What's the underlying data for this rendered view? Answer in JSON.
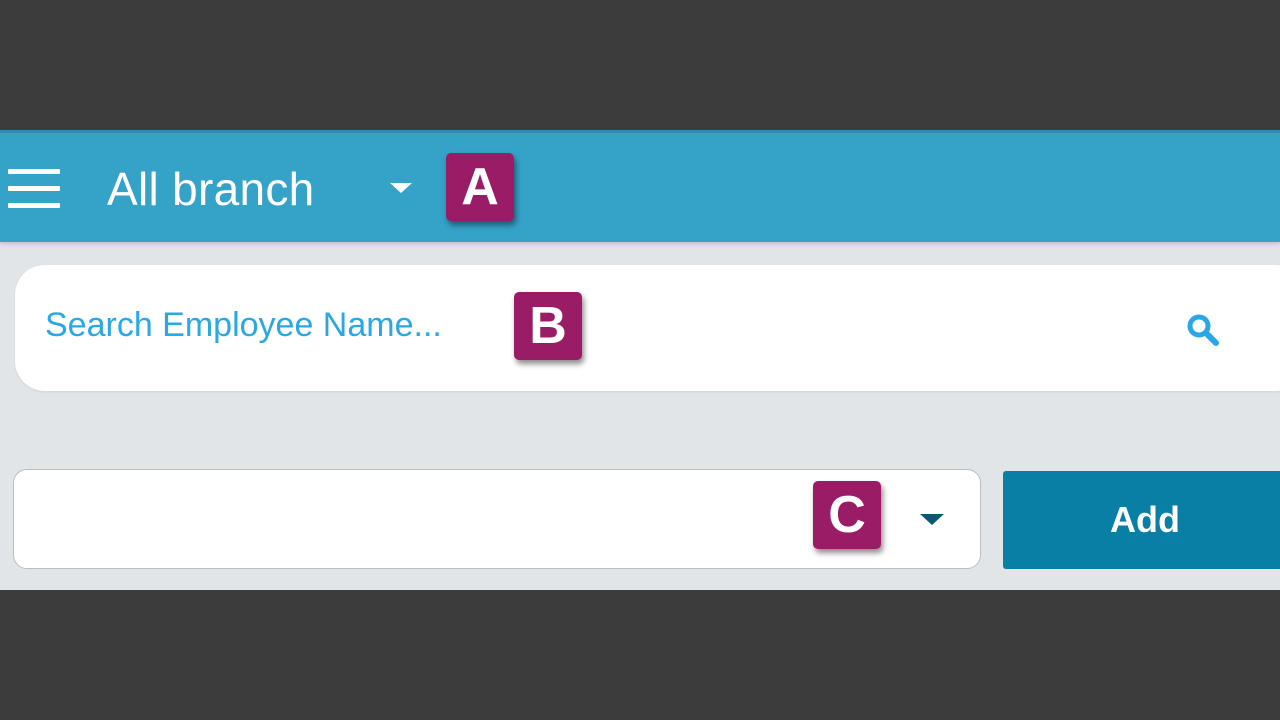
{
  "header": {
    "branch_selector": "All branch"
  },
  "search": {
    "placeholder": "Search Employee Name..."
  },
  "form": {
    "select_value": "",
    "add_label": "Add"
  },
  "annotations": {
    "a": "A",
    "b": "B",
    "c": "C"
  },
  "colors": {
    "appbar": "#35a2c8",
    "badge": "#9b1c66",
    "search_text": "#2aa7e6",
    "add_button": "#0a7fa6",
    "background": "#e1e5e8",
    "frame": "#3c3c3c"
  },
  "icons": {
    "menu": "menu-icon",
    "branch_dropdown": "caret-down-icon",
    "search": "search-icon",
    "select_dropdown": "caret-down-icon"
  }
}
